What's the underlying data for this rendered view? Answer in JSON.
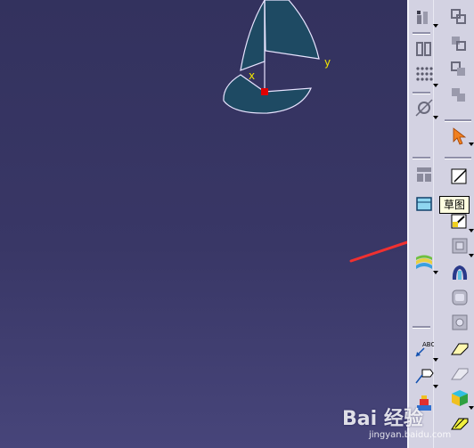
{
  "viewport": {
    "axis_x_label": "x",
    "axis_y_label": "y",
    "bg_top": "#33325e",
    "bg_bottom": "#47457a",
    "plane_fill": "#1e4a63",
    "plane_edge": "#e8e4ff",
    "origin_color": "#e00000",
    "axis_label_color": "#f2e600",
    "annotation_arrow_color": "#f03030"
  },
  "toolbar": {
    "background": "#d3d2e2",
    "icons": [
      "constraint-icon",
      "constraint-icon",
      "grid-icon",
      "snap-point-icon",
      "select-arrow-icon",
      "view-layout-icon",
      "view-box-icon",
      "sketch-icon",
      "sketch-with-positioning-icon",
      "surface-layers-icon",
      "pad-icon",
      "shell-icon",
      "pocket-icon",
      "annotation-text-icon",
      "flag-note-icon",
      "part-design-icon",
      "fillet-icon",
      "draft-icon",
      "cube-icon",
      "edit-icon"
    ],
    "tooltip": "草图"
  },
  "watermark": {
    "brand": "Bai 经验",
    "url": "jingyan.baidu.com"
  }
}
